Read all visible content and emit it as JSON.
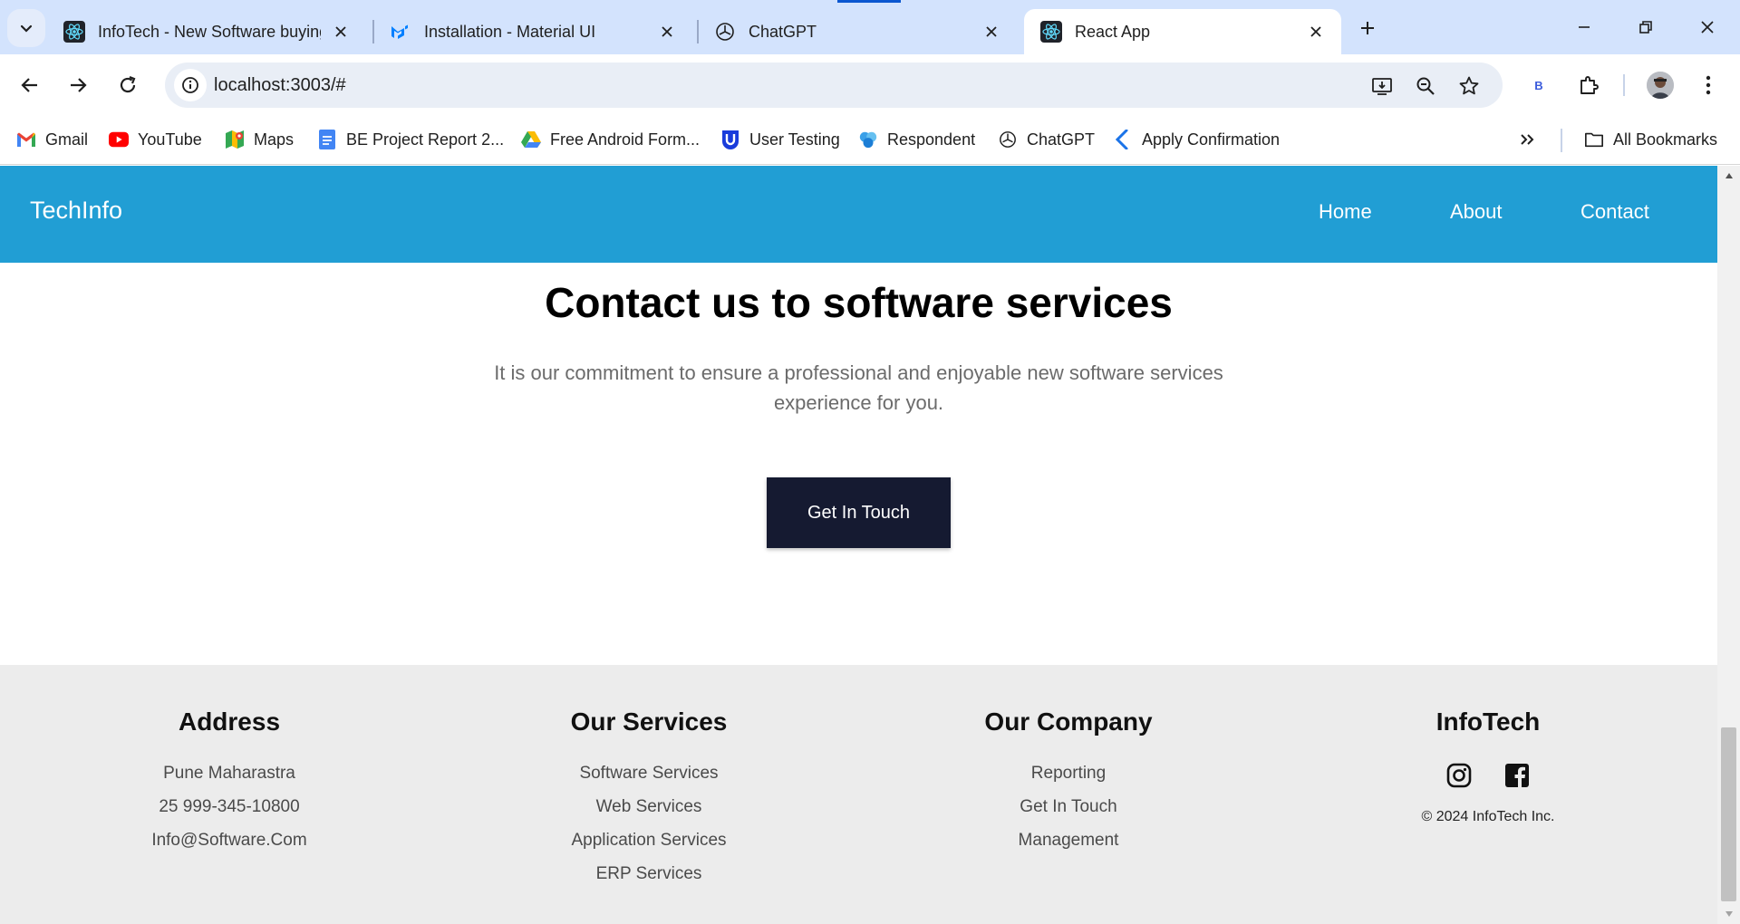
{
  "browser": {
    "tabs": [
      {
        "title": "InfoTech - New Software buying",
        "favicon": "react-icon"
      },
      {
        "title": "Installation - Material UI",
        "favicon": "mui-icon"
      },
      {
        "title": "ChatGPT",
        "favicon": "chatgpt-icon"
      },
      {
        "title": "React App",
        "favicon": "react-icon",
        "active": true
      }
    ],
    "url": "localhost:3003/#",
    "profile_letter": "B",
    "bookmarks": [
      {
        "label": "Gmail",
        "icon": "gmail-icon"
      },
      {
        "label": "YouTube",
        "icon": "youtube-icon"
      },
      {
        "label": "Maps",
        "icon": "maps-icon"
      },
      {
        "label": "BE Project Report 2...",
        "icon": "docs-icon"
      },
      {
        "label": "Free Android Form...",
        "icon": "drive-icon"
      },
      {
        "label": "User Testing",
        "icon": "usertesting-icon"
      },
      {
        "label": "Respondent",
        "icon": "respondent-icon"
      },
      {
        "label": "ChatGPT",
        "icon": "chatgpt-icon"
      },
      {
        "label": "Apply Confirmation",
        "icon": "apply-icon"
      }
    ],
    "all_bookmarks": "All Bookmarks"
  },
  "navbar": {
    "brand": "TechInfo",
    "links": [
      "Home",
      "About",
      "Contact"
    ]
  },
  "hero": {
    "title": "Contact us to software services",
    "text": "It is our commitment to ensure a professional and enjoyable new software services experience for you.",
    "button": "Get In Touch"
  },
  "footer": {
    "address": {
      "heading": "Address",
      "items": [
        "Pune Maharastra",
        "25 999-345-10800",
        "Info@Software.Com"
      ]
    },
    "services": {
      "heading": "Our Services",
      "items": [
        "Software Services",
        "Web Services",
        "Application Services",
        "ERP Services"
      ]
    },
    "company": {
      "heading": "Our Company",
      "items": [
        "Reporting",
        "Get In Touch",
        "Management"
      ]
    },
    "infotech": {
      "heading": "InfoTech",
      "copyright": "© 2024 InfoTech Inc."
    }
  },
  "colors": {
    "navbar_bg": "#219ed4",
    "button_bg": "#151a31",
    "footer_bg": "#ececec",
    "tabstrip_bg": "#d3e3fd"
  }
}
